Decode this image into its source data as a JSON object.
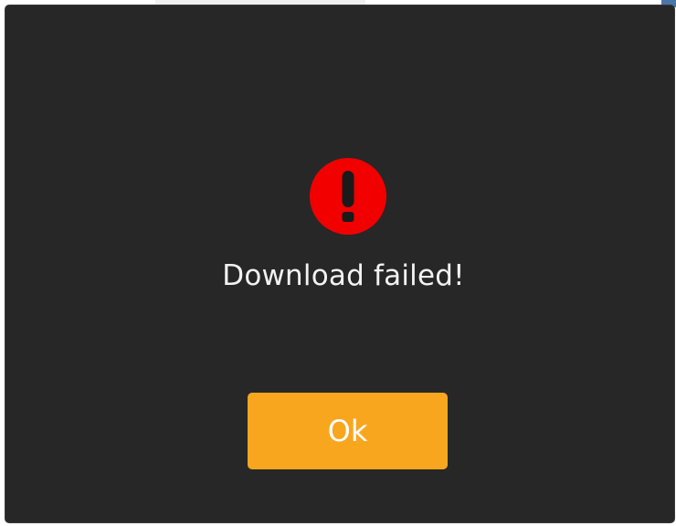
{
  "dialog": {
    "icon": "exclamation-circle-icon",
    "message": "Download failed!",
    "ok_label": "Ok"
  },
  "colors": {
    "dialog_background": "#272727",
    "icon_red": "#f20000",
    "button_accent": "#f9a61f",
    "text": "#f2f2f2"
  }
}
